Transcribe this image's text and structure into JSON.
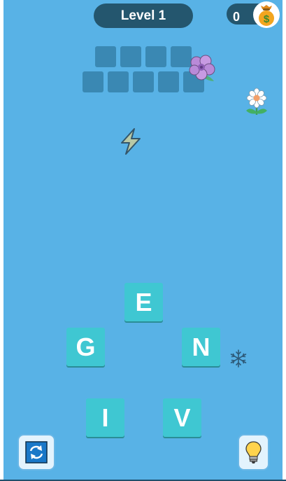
{
  "header": {
    "level_label": "Level 1",
    "coins": "0"
  },
  "answer_rows": [
    {
      "slots": 4
    },
    {
      "slots": 5
    }
  ],
  "letters": {
    "top": "E",
    "left": "G",
    "right": "N",
    "bottom_left": "I",
    "bottom_right": "V"
  },
  "icons": {
    "coin_bag": "money-bag-icon",
    "hibiscus": "hibiscus-flower-icon",
    "daisy": "daisy-flower-icon",
    "lightning": "lightning-icon",
    "snowflake": "snowflake-icon",
    "shuffle": "shuffle-icon",
    "hint": "lightbulb-icon"
  },
  "colors": {
    "background": "#58b2e6",
    "pill": "#24566e",
    "letter_tile": "#3fc7d2",
    "empty_slot": "#3a88b3"
  }
}
